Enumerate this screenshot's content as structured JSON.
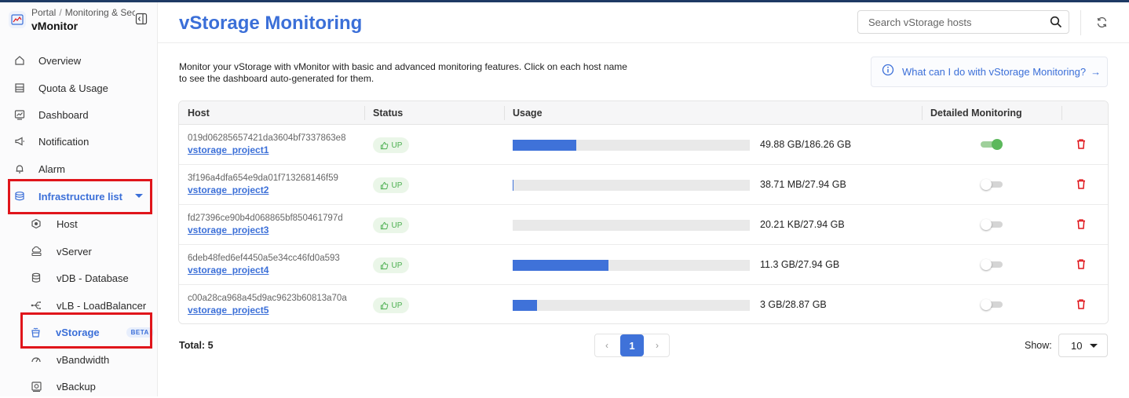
{
  "sidebar": {
    "breadcrumb": [
      "Portal",
      "Monitoring & Security"
    ],
    "app_name": "vMonitor",
    "items": [
      {
        "label": "Overview",
        "icon": "home-icon"
      },
      {
        "label": "Quota & Usage",
        "icon": "quota-icon"
      },
      {
        "label": "Dashboard",
        "icon": "dashboard-icon"
      },
      {
        "label": "Notification",
        "icon": "megaphone-icon"
      },
      {
        "label": "Alarm",
        "icon": "bell-icon"
      },
      {
        "label": "Infrastructure list",
        "icon": "infrastructure-icon",
        "active": true,
        "expanded": true
      }
    ],
    "sub_items": [
      {
        "label": "Host",
        "icon": "hexagon-icon"
      },
      {
        "label": "vServer",
        "icon": "cloud-server-icon"
      },
      {
        "label": "vDB - Database",
        "icon": "database-icon"
      },
      {
        "label": "vLB - LoadBalancer",
        "icon": "loadbalancer-icon"
      },
      {
        "label": "vStorage",
        "icon": "storage-icon",
        "active": true,
        "badge": "BETA"
      },
      {
        "label": "vBandwidth",
        "icon": "gauge-icon"
      },
      {
        "label": "vBackup",
        "icon": "backup-icon"
      }
    ]
  },
  "header": {
    "title": "vStorage Monitoring",
    "search_placeholder": "Search vStorage hosts"
  },
  "main": {
    "description": "Monitor your vStorage with vMonitor with basic and advanced monitoring features. Click on each host name to see the dashboard auto-generated for them.",
    "help_link": "What can I do with vStorage Monitoring?",
    "table": {
      "columns": [
        "Host",
        "Status",
        "Usage",
        "Detailed Monitoring",
        ""
      ],
      "rows": [
        {
          "host_id": "019d06285657421da3604bf7337863e8",
          "host_name": "vstorage_project1",
          "status": "UP",
          "usage_fraction": 0.268,
          "usage_text": "49.88 GB/186.26 GB",
          "detailed_monitoring": true
        },
        {
          "host_id": "3f196a4dfa654e9da01f713268146f59",
          "host_name": "vstorage_project2",
          "status": "UP",
          "usage_fraction": 0.0014,
          "usage_text": "38.71 MB/27.94 GB",
          "detailed_monitoring": false
        },
        {
          "host_id": "fd27396ce90b4d068865bf850461797d",
          "host_name": "vstorage_project3",
          "status": "UP",
          "usage_fraction": 0,
          "usage_text": "20.21 KB/27.94 GB",
          "detailed_monitoring": false
        },
        {
          "host_id": "6deb48fed6ef4450a5e34cc46fd0a593",
          "host_name": "vstorage_project4",
          "status": "UP",
          "usage_fraction": 0.404,
          "usage_text": "11.3 GB/27.94 GB",
          "detailed_monitoring": false
        },
        {
          "host_id": "c00a28ca968a45d9ac9623b60813a70a",
          "host_name": "vstorage_project5",
          "status": "UP",
          "usage_fraction": 0.104,
          "usage_text": "3 GB/28.87 GB",
          "detailed_monitoring": false
        }
      ]
    },
    "footer": {
      "total": "Total: 5",
      "current_page": "1",
      "show_label": "Show:",
      "page_size": "10"
    }
  },
  "colors": {
    "accent": "#3b6fd8",
    "bar": "#3f72d9",
    "status_up": "#4caf50",
    "toggle_on": "#5cb85c",
    "delete": "#e0151b"
  }
}
